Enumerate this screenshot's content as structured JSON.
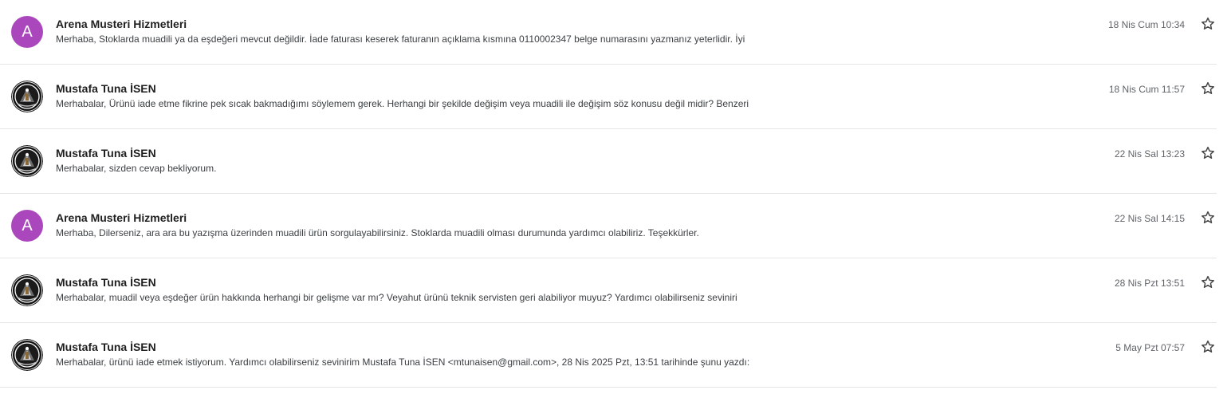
{
  "messages": [
    {
      "sender": "Arena Musteri Hizmetleri",
      "avatar_type": "letter",
      "avatar_letter": "A",
      "snippet": "Merhaba, Stoklarda muadili ya da eşdeğeri mevcut değildir. İade faturası keserek faturanın açıklama kısmına 0110002347 belge numarasını yazmanız yeterlidir. İyi",
      "date": "18 Nis Cum 10:34"
    },
    {
      "sender": "Mustafa Tuna İSEN",
      "avatar_type": "photo",
      "avatar_letter": "",
      "snippet": "Merhabalar, Ürünü iade etme fikrine pek sıcak bakmadığımı söylemem gerek. Herhangi bir şekilde değişim veya muadili ile değişim söz konusu değil midir? Benzeri",
      "date": "18 Nis Cum 11:57"
    },
    {
      "sender": "Mustafa Tuna İSEN",
      "avatar_type": "photo",
      "avatar_letter": "",
      "snippet": "Merhabalar, sizden cevap bekliyorum.",
      "date": "22 Nis Sal 13:23"
    },
    {
      "sender": "Arena Musteri Hizmetleri",
      "avatar_type": "letter",
      "avatar_letter": "A",
      "snippet": "Merhaba, Dilerseniz, ara ara bu yazışma üzerinden muadili ürün sorgulayabilirsiniz. Stoklarda muadili olması durumunda yardımcı olabiliriz. Teşekkürler.",
      "date": "22 Nis Sal 14:15"
    },
    {
      "sender": "Mustafa Tuna İSEN",
      "avatar_type": "photo",
      "avatar_letter": "",
      "snippet": "Merhabalar, muadil veya eşdeğer ürün hakkında herhangi bir gelişme var mı? Veyahut ürünü teknik servisten geri alabiliyor muyuz? Yardımcı olabilirseniz seviniri",
      "date": "28 Nis Pzt 13:51"
    },
    {
      "sender": "Mustafa Tuna İSEN",
      "avatar_type": "photo",
      "avatar_letter": "",
      "snippet": "Merhabalar, ürünü iade etmek istiyorum. Yardımcı olabilirseniz sevinirim Mustafa Tuna İSEN <mtunaisen@gmail.com>, 28 Nis 2025 Pzt, 13:51 tarihinde şunu yazdı:",
      "date": "5 May Pzt 07:57"
    }
  ],
  "icons": {
    "star": "star-outline-icon",
    "photo": "profile-photo"
  },
  "colors": {
    "letter_avatar": "#ab47bc",
    "sender_text": "#1f1f1f",
    "snippet_text": "#3c4043",
    "date_text": "#5f6368",
    "divider": "#e6e6e6"
  }
}
